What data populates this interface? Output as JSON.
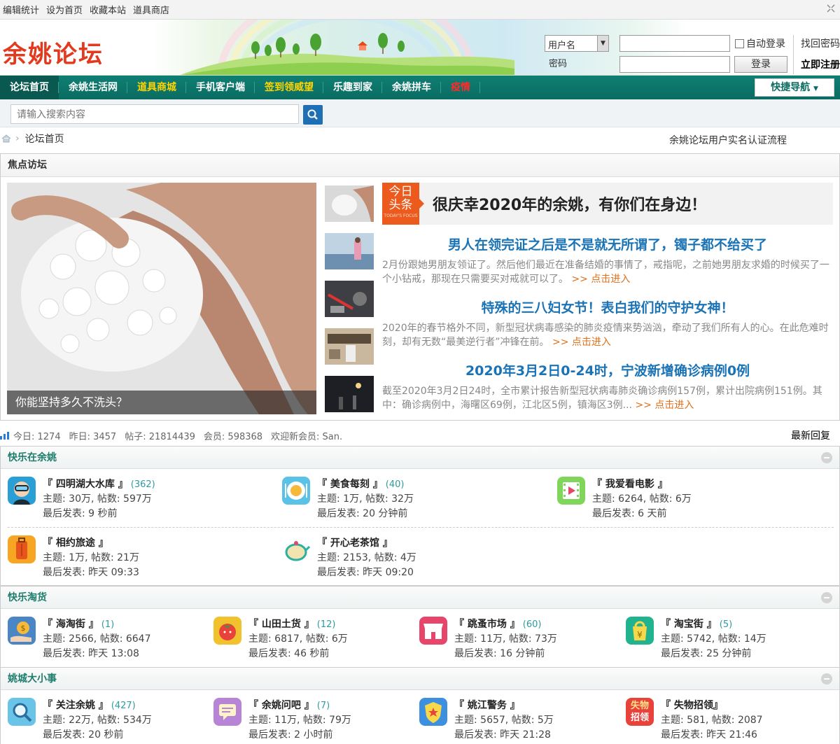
{
  "topbar": [
    "编辑统计",
    "设为首页",
    "收藏本站",
    "道具商店"
  ],
  "brand": {
    "logo_text": "余姚论坛"
  },
  "login": {
    "username_select": "用户名",
    "password_label": "密码",
    "auto_login": "自动登录",
    "login_button": "登录",
    "forgot": "找回密码",
    "register": "立即注册"
  },
  "nav": {
    "items": [
      {
        "label": "论坛首页",
        "style": "active"
      },
      {
        "label": "余姚生活网",
        "style": "normal"
      },
      {
        "label": "道具商城",
        "style": "yellow"
      },
      {
        "label": "手机客户端",
        "style": "normal"
      },
      {
        "label": "签到领威望",
        "style": "yellow"
      },
      {
        "label": "乐趣到家",
        "style": "normal"
      },
      {
        "label": "余姚拼车",
        "style": "normal"
      },
      {
        "label": "疫情",
        "style": "red"
      }
    ],
    "quick_nav": "快捷导航"
  },
  "search": {
    "placeholder": "请输入搜索内容"
  },
  "breadcrumb": {
    "current": "论坛首页",
    "auth_link": "余姚论坛用户实名认证流程"
  },
  "focus": {
    "title": "焦点访坛",
    "big_caption": "你能坚持多久不洗头？",
    "today_label_1": "今日",
    "today_label_2": "头条",
    "today_en": "TODAY'S FOCUS",
    "headline": "很庆幸2020年的余姚，有你们在身边！",
    "news": [
      {
        "title": "男人在领完证之后是不是就无所谓了，镯子都不给买了",
        "desc": "2月份跟她男朋友领证了。然后他们最近在准备结婚的事情了，戒指呢，之前她男朋友求婚的时候买了一个小钻戒，那现在只需要买对戒就可以了。",
        "more": ">> 点击进入"
      },
      {
        "title": "特殊的三八妇女节！表白我们的守护女神！",
        "desc": "2020年的春节格外不同，新型冠状病毒感染的肺炎疫情来势汹汹，牵动了我们所有人的心。在此危难时刻，却有无数“最美逆行者”冲锋在前。",
        "more": ">> 点击进入"
      },
      {
        "title": "2020年3月2日0-24时，宁波新增确诊病例0例",
        "desc": "截至2020年3月2日24时，全市累计报告新型冠状病毒肺炎确诊病例157例，累计出院病例151例。其中：确诊病例中，海曙区69例，江北区5例，镇海区3例...",
        "more": ">> 点击进入"
      }
    ]
  },
  "stats": {
    "today": "今日: 1274",
    "yesterday": "昨日: 3457",
    "posts": "帖子: 21814439",
    "members": "会员: 598368",
    "welcome": "欢迎新会员: San.",
    "latest": "最新回复"
  },
  "groups": [
    {
      "title": "快乐在余姚",
      "forums": [
        {
          "name": "『 四明湖大水库 』",
          "today": "(362)",
          "stats": "主题: 30万, 帖数: 597万",
          "last": "最后发表: 9 秒前",
          "icon": "diver-icon",
          "color": "#2a9fd6"
        },
        {
          "name": "『 美食每刻 』",
          "today": "(40)",
          "stats": "主题: 1万, 帖数: 32万",
          "last": "最后发表: 20 分钟前",
          "icon": "plate-icon",
          "color": "#5bc2e7"
        },
        {
          "name": "『 我爱看电影 』",
          "today": "",
          "stats": "主题: 6264, 帖数: 6万",
          "last": "最后发表: 6 天前",
          "icon": "film-icon",
          "color": "#7fd65a"
        },
        {
          "name": "『 相约旅途 』",
          "today": "",
          "stats": "主题: 1万, 帖数: 21万",
          "last": "最后发表: 昨天 09:33",
          "icon": "suitcase-icon",
          "color": "#f6a623"
        },
        {
          "name": "『 开心老茶馆 』",
          "today": "",
          "stats": "主题: 2153, 帖数: 4万",
          "last": "最后发表: 昨天 09:20",
          "icon": "teapot-icon",
          "color": "#f3e3b0"
        }
      ]
    },
    {
      "title": "快乐淘货",
      "forums": [
        {
          "name": "『 海淘街 』",
          "today": "(1)",
          "stats": "主题: 2566, 帖数: 6647",
          "last": "最后发表: 昨天 13:08",
          "icon": "coin-hand-icon",
          "color": "#4a86c5"
        },
        {
          "name": "『 山田土货 』",
          "today": "(12)",
          "stats": "主题: 6817, 帖数: 6万",
          "last": "最后发表: 46 秒前",
          "icon": "tomato-icon",
          "color": "#f2c12e"
        },
        {
          "name": "『 跳蚤市场 』",
          "today": "(60)",
          "stats": "主题: 11万, 帖数: 73万",
          "last": "最后发表: 16 分钟前",
          "icon": "shop-icon",
          "color": "#e8456a"
        },
        {
          "name": "『 淘宝街 』",
          "today": "(5)",
          "stats": "主题: 5742, 帖数: 14万",
          "last": "最后发表: 25 分钟前",
          "icon": "yen-bag-icon",
          "color": "#21b38f"
        }
      ]
    },
    {
      "title": "姚城大小事",
      "forums": [
        {
          "name": "『 关注余姚 』",
          "today": "(427)",
          "stats": "主题: 22万, 帖数: 534万",
          "last": "最后发表: 20 秒前",
          "icon": "magnifier-icon",
          "color": "#6ac4e8"
        },
        {
          "name": "『 余姚问吧 』",
          "today": "(7)",
          "stats": "主题: 11万, 帖数: 79万",
          "last": "最后发表: 2 小时前",
          "icon": "chat-icon",
          "color": "#b784d6"
        },
        {
          "name": "『 姚江警务 』",
          "today": "",
          "stats": "主题: 5657, 帖数: 5万",
          "last": "最后发表: 昨天 21:28",
          "icon": "police-badge-icon",
          "color": "#3d8fe0"
        },
        {
          "name": "『 失物招领』",
          "today": "",
          "stats": "主题: 581, 帖数: 2087",
          "last": "最后发表: 昨天 21:46",
          "icon": "lost-found-icon",
          "color": "#e8433a",
          "icon_text_1": "失物",
          "icon_text_2": "招领"
        }
      ]
    }
  ]
}
